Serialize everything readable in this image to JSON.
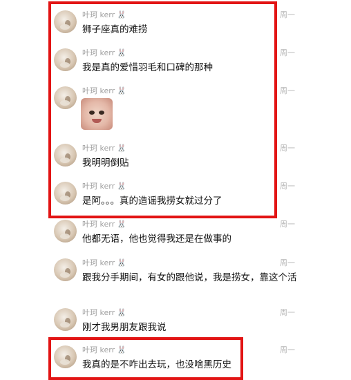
{
  "chat": {
    "messages": [
      {
        "name": "叶珂 kerr",
        "time": "周一",
        "text": "狮子座真的难捞"
      },
      {
        "name": "叶珂 kerr",
        "time": "周一",
        "text": "我是真的爱惜羽毛和口碑的那种"
      },
      {
        "name": "叶珂 kerr",
        "time": "周一",
        "sticker": "baby-face-sticker"
      },
      {
        "name": "叶珂 kerr",
        "time": "周一",
        "text": "我明明倒贴"
      },
      {
        "name": "叶珂 kerr",
        "time": "周一",
        "text": "是阿。。。真的造谣我捞女就过分了"
      },
      {
        "name": "叶珂 kerr",
        "time": "周一",
        "text": "他都无语，他也觉得我还是在做事的"
      },
      {
        "name": "叶珂 kerr",
        "time": "周一",
        "text": "跟我分手期间，有女的跟他说，我是捞女，靠这个活"
      },
      {
        "name": "叶珂 kerr",
        "time": "周一",
        "text": "刚才我男朋友跟我说"
      },
      {
        "name": "叶珂 kerr",
        "time": "周一",
        "text": "我真的是不咋出去玩，也没啥黑历史"
      }
    ]
  },
  "icons": {
    "name_suffix_icon": "bunny-icon"
  },
  "colors": {
    "highlight_box": "#e21414"
  }
}
